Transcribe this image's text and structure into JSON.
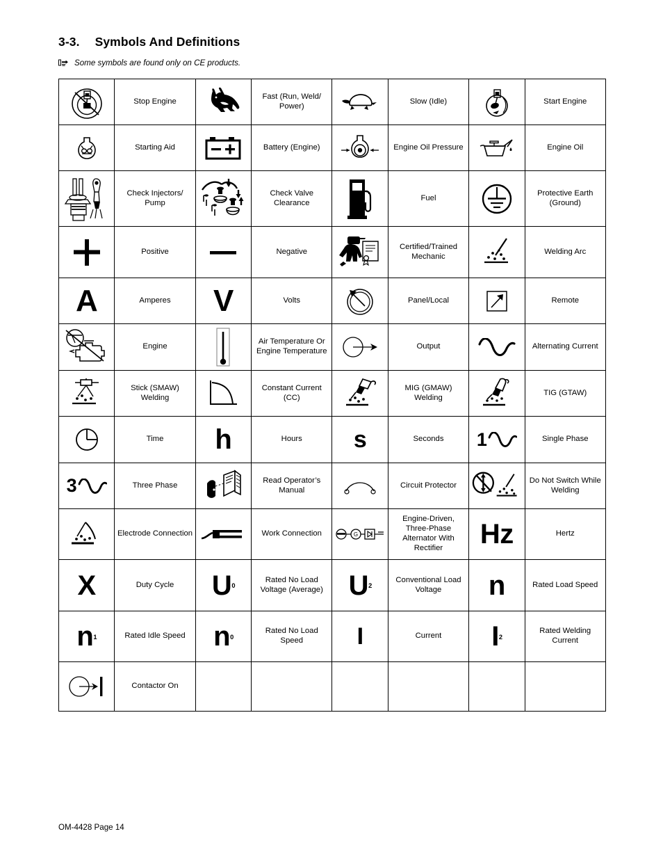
{
  "document": {
    "section_number": "3-3.",
    "section_title": "Symbols And Definitions",
    "note": "Some symbols are found only on CE products.",
    "note_icon": "pointing-hand-icon",
    "footer": "OM-4428 Page 14"
  },
  "table": {
    "rows": [
      [
        {
          "icon": "stop-engine-icon",
          "label": "Stop Engine"
        },
        {
          "icon": "rabbit-fast-icon",
          "label": "Fast (Run, Weld/ Power)"
        },
        {
          "icon": "turtle-slow-icon",
          "label": "Slow (Idle)"
        },
        {
          "icon": "start-engine-icon",
          "label": "Start Engine"
        }
      ],
      [
        {
          "icon": "starting-aid-icon",
          "label": "Starting Aid"
        },
        {
          "icon": "battery-icon",
          "label": "Battery (Engine)"
        },
        {
          "icon": "engine-oil-pressure-icon",
          "label": "Engine Oil Pressure"
        },
        {
          "icon": "engine-oil-can-icon",
          "label": "Engine Oil"
        }
      ],
      [
        {
          "icon": "check-injectors-pump-icon",
          "label": "Check Injectors/ Pump"
        },
        {
          "icon": "check-valve-clearance-icon",
          "label": "Check Valve Clearance"
        },
        {
          "icon": "fuel-pump-icon",
          "label": "Fuel"
        },
        {
          "icon": "protective-earth-ground-icon",
          "label": "Protective Earth (Ground)"
        }
      ],
      [
        {
          "icon": "plus-sign-icon",
          "label": "Positive"
        },
        {
          "icon": "minus-sign-icon",
          "label": "Negative"
        },
        {
          "icon": "certified-mechanic-icon",
          "label": "Certified/Trained Mechanic"
        },
        {
          "icon": "welding-arc-icon",
          "label": "Welding Arc"
        }
      ],
      [
        {
          "icon": "letter-a-icon",
          "label": "Amperes"
        },
        {
          "icon": "letter-v-icon",
          "label": "Volts"
        },
        {
          "icon": "panel-local-dial-icon",
          "label": "Panel/Local"
        },
        {
          "icon": "remote-arrow-icon",
          "label": "Remote"
        }
      ],
      [
        {
          "icon": "engine-icon",
          "label": "Engine"
        },
        {
          "icon": "thermometer-icon",
          "label": "Air Temperature Or Engine Temperature"
        },
        {
          "icon": "output-icon",
          "label": "Output"
        },
        {
          "icon": "alternating-current-icon",
          "label": "Alternating Current"
        }
      ],
      [
        {
          "icon": "stick-smaw-welding-icon",
          "label": "Stick (SMAW) Welding"
        },
        {
          "icon": "constant-current-icon",
          "label": "Constant Current (CC)"
        },
        {
          "icon": "mig-gmaw-welding-icon",
          "label": "MIG (GMAW) Welding"
        },
        {
          "icon": "tig-gtaw-welding-icon",
          "label": "TIG (GTAW)"
        }
      ],
      [
        {
          "icon": "clock-time-icon",
          "label": "Time"
        },
        {
          "icon": "letter-h-icon",
          "label": "Hours"
        },
        {
          "icon": "letter-s-icon",
          "label": "Seconds"
        },
        {
          "icon": "single-phase-icon",
          "label": "Single Phase"
        }
      ],
      [
        {
          "icon": "three-phase-icon",
          "label": "Three Phase"
        },
        {
          "icon": "read-operators-manual-icon",
          "label": "Read Operator’s Manual"
        },
        {
          "icon": "circuit-protector-icon",
          "label": "Circuit Protector"
        },
        {
          "icon": "do-not-switch-while-welding-icon",
          "label": "Do Not Switch While Welding"
        }
      ],
      [
        {
          "icon": "electrode-connection-icon",
          "label": "Electrode Connection"
        },
        {
          "icon": "work-connection-icon",
          "label": "Work Connection"
        },
        {
          "icon": "engine-driven-alternator-rectifier-icon",
          "label": "Engine-Driven, Three-Phase Alternator With Rectifier"
        },
        {
          "icon": "hertz-icon",
          "label": "Hertz"
        }
      ],
      [
        {
          "icon": "letter-x-icon",
          "label": "Duty Cycle"
        },
        {
          "icon": "u-sub-zero-icon",
          "label": "Rated No Load Voltage (Average)"
        },
        {
          "icon": "u-sub-two-icon",
          "label": "Conventional Load Voltage"
        },
        {
          "icon": "letter-n-icon",
          "label": "Rated Load Speed"
        }
      ],
      [
        {
          "icon": "n-sub-one-icon",
          "label": "Rated Idle Speed"
        },
        {
          "icon": "n-sub-zero-icon",
          "label": "Rated No Load Speed"
        },
        {
          "icon": "letter-i-icon",
          "label": "Current"
        },
        {
          "icon": "i-sub-two-icon",
          "label": "Rated Welding Current"
        }
      ],
      [
        {
          "icon": "contactor-on-icon",
          "label": "Contactor On"
        },
        {
          "icon": "",
          "label": ""
        },
        {
          "icon": "",
          "label": ""
        },
        {
          "icon": "",
          "label": ""
        }
      ]
    ],
    "symbol_text": {
      "plus": "+",
      "minus": "—",
      "letter_a": "A",
      "letter_v": "V",
      "letter_h": "h",
      "letter_s": "s",
      "letter_x": "X",
      "letter_n": "n",
      "letter_i": "I",
      "hertz": "Hz",
      "u": "U",
      "sub_0": "0",
      "sub_1": "1",
      "sub_2": "2",
      "phase_one": "1",
      "phase_three": "3"
    }
  },
  "colors": {
    "ink": "#000000",
    "paper": "#ffffff",
    "rule": "#000000"
  }
}
